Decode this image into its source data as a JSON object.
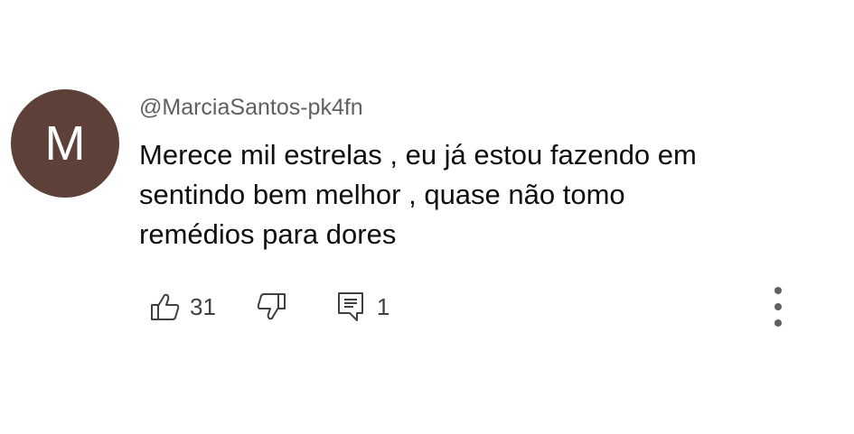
{
  "comment": {
    "avatar_letter": "M",
    "avatar_color": "#5d4037",
    "author": "@MarciaSantos-pk4fn",
    "text_lines": [
      "Merece mil estrelas , eu já estou fazendo em",
      "sentindo bem melhor , quase não tomo",
      "remédios para dores"
    ],
    "likes": "31",
    "replies": "1"
  },
  "icons": {
    "like": "thumbs-up-icon",
    "dislike": "thumbs-down-icon",
    "reply": "reply-comment-icon",
    "menu": "more-vert-icon"
  }
}
